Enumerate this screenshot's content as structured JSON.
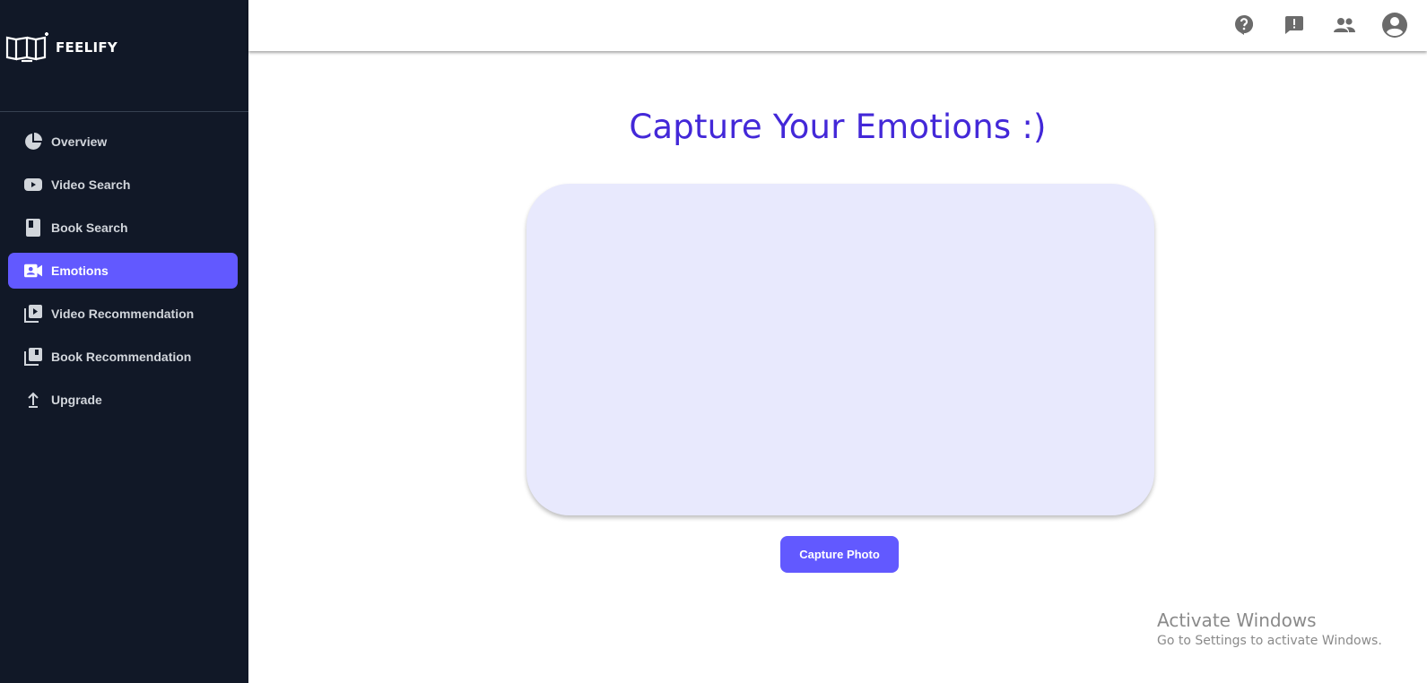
{
  "brand": {
    "name": "FEELIFY"
  },
  "sidebar": {
    "items": [
      {
        "label": "Overview",
        "icon": "pie-chart-icon",
        "active": false
      },
      {
        "label": "Video Search",
        "icon": "youtube-icon",
        "active": false
      },
      {
        "label": "Book Search",
        "icon": "book-icon",
        "active": false
      },
      {
        "label": "Emotions",
        "icon": "contact-video-icon",
        "active": true
      },
      {
        "label": "Video Recommendation",
        "icon": "video-library-icon",
        "active": false
      },
      {
        "label": "Book Recommendation",
        "icon": "library-books-icon",
        "active": false
      },
      {
        "label": "Upgrade",
        "icon": "upload-arrow-icon",
        "active": false
      }
    ]
  },
  "topbar": {
    "icons": [
      "help-icon",
      "feedback-icon",
      "people-icon",
      "account-icon"
    ]
  },
  "main": {
    "title": "Capture Your Emotions :)",
    "capture_button": "Capture Photo"
  },
  "watermark": {
    "title": "Activate Windows",
    "subtitle": "Go to Settings to activate Windows."
  },
  "colors": {
    "sidebar_bg": "#111827",
    "accent": "#6259ff",
    "title": "#4328d8",
    "camera_bg": "#e8e9fd"
  }
}
